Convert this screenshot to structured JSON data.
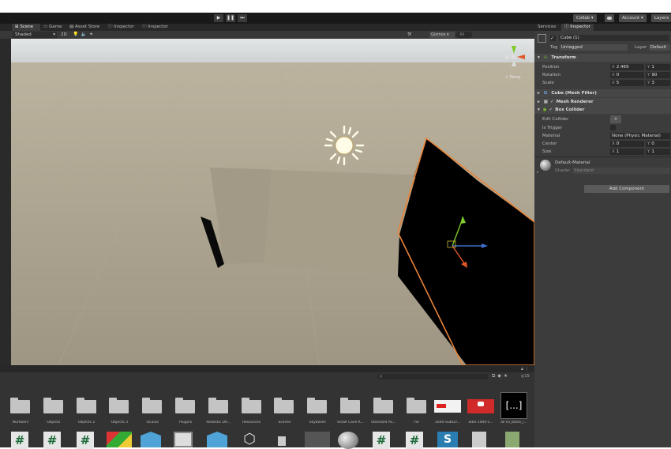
{
  "toolbar": {
    "play": "▶",
    "pause": "❚❚",
    "step": "⏭",
    "collab": "Collab ▾",
    "account": "Account ▾",
    "layers": "Layers"
  },
  "tabs": {
    "scene": "Scene",
    "game": "Game",
    "asset_store": "Asset Store",
    "inspector1": "Inspector",
    "inspector2": "Inspector"
  },
  "scene_toolbar": {
    "shading": "Shaded",
    "mode_2d": "2D",
    "gizmos": "Gizmos",
    "search": "All"
  },
  "viewport": {
    "persp_label": "< Persp"
  },
  "right_tabs": {
    "services": "Services",
    "inspector": "Inspector"
  },
  "object": {
    "name": "Cube (1)",
    "tag_label": "Tag",
    "tag_value": "Untagged",
    "layer_label": "Layer",
    "layer_value": "Default"
  },
  "transform": {
    "title": "Transform",
    "position_label": "Position",
    "position": {
      "x": "2.469",
      "y": "1"
    },
    "rotation_label": "Rotation",
    "rotation": {
      "x": "0",
      "y": "90"
    },
    "scale_label": "Scale",
    "scale": {
      "x": "5",
      "y": "3"
    }
  },
  "components": {
    "mesh_filter": "Cube (Mesh Filter)",
    "mesh_renderer": "Mesh Renderer",
    "box_collider": "Box Collider"
  },
  "box_collider": {
    "edit_label": "Edit Collider",
    "trigger_label": "Is Trigger",
    "material_label": "Material",
    "material_value": "None (Physic Material)",
    "center_label": "Center",
    "center": {
      "x": "0",
      "y": "0"
    },
    "size_label": "Size",
    "size": {
      "x": "1",
      "y": "1"
    }
  },
  "material": {
    "name": "Default-Material",
    "shader_label": "Shader",
    "shader_value": "Standard"
  },
  "add_component": "Add Component",
  "project": {
    "count": "15",
    "folders": [
      "Numbers",
      "Objects",
      "Objects 2",
      "Objects 3",
      "Oculus",
      "Plugins",
      "Realistic DR...",
      "Resources",
      "Scenes",
      "Skyboxes",
      "Small Cave K...",
      "Standard As...",
      "TSF"
    ],
    "thumbs": [
      "1000-Subscr...",
      "adi0-1000-s...",
      "all lvl_black_i..."
    ]
  },
  "colors": {
    "accent": "#3e6fc9",
    "selection": "#e8843a",
    "ground": "#a8a08c",
    "sky": "#cfd3d6"
  }
}
